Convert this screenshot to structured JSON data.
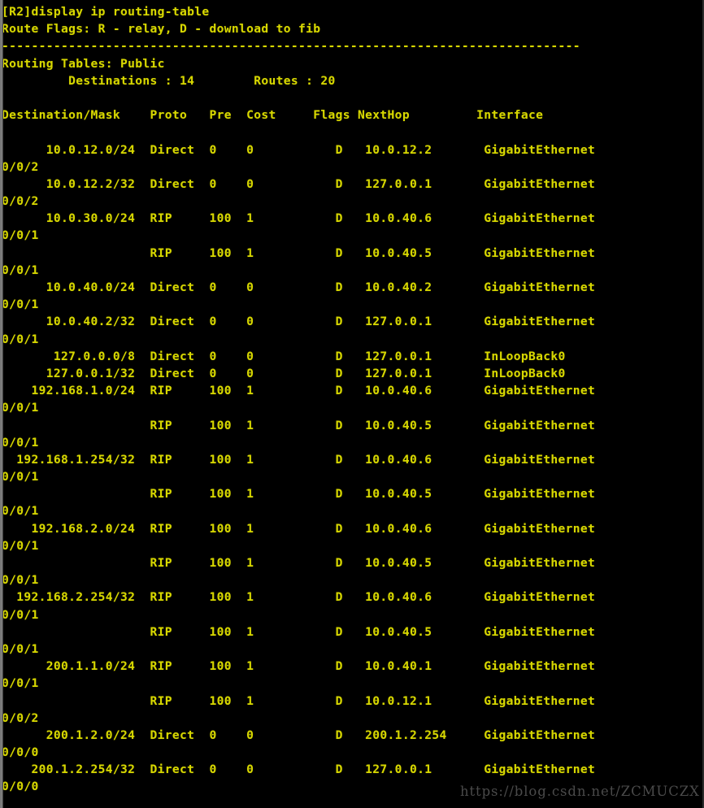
{
  "terminal": {
    "prompt_line": "[R2]display ip routing-table",
    "route_flags_line": "Route Flags: R - relay, D - download to fib",
    "separator": "------------------------------------------------------------------------------",
    "routing_tables_line": "Routing Tables: Public",
    "summary_line": "         Destinations : 14        Routes : 20",
    "blank": "",
    "header_line": "Destination/Mask    Proto   Pre  Cost     Flags NextHop         Interface",
    "columns": {
      "destination_mask": "Destination/Mask",
      "proto": "Proto",
      "pre": "Pre",
      "cost": "Cost",
      "flags": "Flags",
      "nexthop": "NextHop",
      "interface": "Interface"
    },
    "counts": {
      "destinations": "14",
      "routes": "20"
    },
    "watermark": "https://blog.csdn.net/ZCMUCZX",
    "colors": {
      "background": "#000000",
      "foreground": "#d7d700",
      "watermark": "#4a4a4a",
      "gutter": "#8a8a8a"
    },
    "routes": [
      {
        "destination_mask": "10.0.12.0/24",
        "proto": "Direct",
        "pre": "0",
        "cost": "0",
        "flags": "D",
        "nexthop": "10.0.12.2",
        "interface": "GigabitEthernet",
        "interface_cont": "0/0/2",
        "line": "      10.0.12.0/24  Direct  0    0           D   10.0.12.2       GigabitEthernet",
        "line_cont": "0/0/2"
      },
      {
        "destination_mask": "10.0.12.2/32",
        "proto": "Direct",
        "pre": "0",
        "cost": "0",
        "flags": "D",
        "nexthop": "127.0.0.1",
        "interface": "GigabitEthernet",
        "interface_cont": "0/0/2",
        "line": "      10.0.12.2/32  Direct  0    0           D   127.0.0.1       GigabitEthernet",
        "line_cont": "0/0/2"
      },
      {
        "destination_mask": "10.0.30.0/24",
        "proto": "RIP",
        "pre": "100",
        "cost": "1",
        "flags": "D",
        "nexthop": "10.0.40.6",
        "interface": "GigabitEthernet",
        "interface_cont": "0/0/1",
        "line": "      10.0.30.0/24  RIP     100  1           D   10.0.40.6       GigabitEthernet",
        "line_cont": "0/0/1"
      },
      {
        "destination_mask": "",
        "proto": "RIP",
        "pre": "100",
        "cost": "1",
        "flags": "D",
        "nexthop": "10.0.40.5",
        "interface": "GigabitEthernet",
        "interface_cont": "0/0/1",
        "line": "                    RIP     100  1           D   10.0.40.5       GigabitEthernet",
        "line_cont": "0/0/1"
      },
      {
        "destination_mask": "10.0.40.0/24",
        "proto": "Direct",
        "pre": "0",
        "cost": "0",
        "flags": "D",
        "nexthop": "10.0.40.2",
        "interface": "GigabitEthernet",
        "interface_cont": "0/0/1",
        "line": "      10.0.40.0/24  Direct  0    0           D   10.0.40.2       GigabitEthernet",
        "line_cont": "0/0/1"
      },
      {
        "destination_mask": "10.0.40.2/32",
        "proto": "Direct",
        "pre": "0",
        "cost": "0",
        "flags": "D",
        "nexthop": "127.0.0.1",
        "interface": "GigabitEthernet",
        "interface_cont": "0/0/1",
        "line": "      10.0.40.2/32  Direct  0    0           D   127.0.0.1       GigabitEthernet",
        "line_cont": "0/0/1"
      },
      {
        "destination_mask": "127.0.0.0/8",
        "proto": "Direct",
        "pre": "0",
        "cost": "0",
        "flags": "D",
        "nexthop": "127.0.0.1",
        "interface": "InLoopBack0",
        "interface_cont": "",
        "line": "       127.0.0.0/8  Direct  0    0           D   127.0.0.1       InLoopBack0",
        "line_cont": ""
      },
      {
        "destination_mask": "127.0.0.1/32",
        "proto": "Direct",
        "pre": "0",
        "cost": "0",
        "flags": "D",
        "nexthop": "127.0.0.1",
        "interface": "InLoopBack0",
        "interface_cont": "",
        "line": "      127.0.0.1/32  Direct  0    0           D   127.0.0.1       InLoopBack0",
        "line_cont": ""
      },
      {
        "destination_mask": "192.168.1.0/24",
        "proto": "RIP",
        "pre": "100",
        "cost": "1",
        "flags": "D",
        "nexthop": "10.0.40.6",
        "interface": "GigabitEthernet",
        "interface_cont": "0/0/1",
        "line": "    192.168.1.0/24  RIP     100  1           D   10.0.40.6       GigabitEthernet",
        "line_cont": "0/0/1"
      },
      {
        "destination_mask": "",
        "proto": "RIP",
        "pre": "100",
        "cost": "1",
        "flags": "D",
        "nexthop": "10.0.40.5",
        "interface": "GigabitEthernet",
        "interface_cont": "0/0/1",
        "line": "                    RIP     100  1           D   10.0.40.5       GigabitEthernet",
        "line_cont": "0/0/1"
      },
      {
        "destination_mask": "192.168.1.254/32",
        "proto": "RIP",
        "pre": "100",
        "cost": "1",
        "flags": "D",
        "nexthop": "10.0.40.6",
        "interface": "GigabitEthernet",
        "interface_cont": "0/0/1",
        "line": "  192.168.1.254/32  RIP     100  1           D   10.0.40.6       GigabitEthernet",
        "line_cont": "0/0/1"
      },
      {
        "destination_mask": "",
        "proto": "RIP",
        "pre": "100",
        "cost": "1",
        "flags": "D",
        "nexthop": "10.0.40.5",
        "interface": "GigabitEthernet",
        "interface_cont": "0/0/1",
        "line": "                    RIP     100  1           D   10.0.40.5       GigabitEthernet",
        "line_cont": "0/0/1"
      },
      {
        "destination_mask": "192.168.2.0/24",
        "proto": "RIP",
        "pre": "100",
        "cost": "1",
        "flags": "D",
        "nexthop": "10.0.40.6",
        "interface": "GigabitEthernet",
        "interface_cont": "0/0/1",
        "line": "    192.168.2.0/24  RIP     100  1           D   10.0.40.6       GigabitEthernet",
        "line_cont": "0/0/1"
      },
      {
        "destination_mask": "",
        "proto": "RIP",
        "pre": "100",
        "cost": "1",
        "flags": "D",
        "nexthop": "10.0.40.5",
        "interface": "GigabitEthernet",
        "interface_cont": "0/0/1",
        "line": "                    RIP     100  1           D   10.0.40.5       GigabitEthernet",
        "line_cont": "0/0/1"
      },
      {
        "destination_mask": "192.168.2.254/32",
        "proto": "RIP",
        "pre": "100",
        "cost": "1",
        "flags": "D",
        "nexthop": "10.0.40.6",
        "interface": "GigabitEthernet",
        "interface_cont": "0/0/1",
        "line": "  192.168.2.254/32  RIP     100  1           D   10.0.40.6       GigabitEthernet",
        "line_cont": "0/0/1"
      },
      {
        "destination_mask": "",
        "proto": "RIP",
        "pre": "100",
        "cost": "1",
        "flags": "D",
        "nexthop": "10.0.40.5",
        "interface": "GigabitEthernet",
        "interface_cont": "0/0/1",
        "line": "                    RIP     100  1           D   10.0.40.5       GigabitEthernet",
        "line_cont": "0/0/1"
      },
      {
        "destination_mask": "200.1.1.0/24",
        "proto": "RIP",
        "pre": "100",
        "cost": "1",
        "flags": "D",
        "nexthop": "10.0.40.1",
        "interface": "GigabitEthernet",
        "interface_cont": "0/0/1",
        "line": "      200.1.1.0/24  RIP     100  1           D   10.0.40.1       GigabitEthernet",
        "line_cont": "0/0/1"
      },
      {
        "destination_mask": "",
        "proto": "RIP",
        "pre": "100",
        "cost": "1",
        "flags": "D",
        "nexthop": "10.0.12.1",
        "interface": "GigabitEthernet",
        "interface_cont": "0/0/2",
        "line": "                    RIP     100  1           D   10.0.12.1       GigabitEthernet",
        "line_cont": "0/0/2"
      },
      {
        "destination_mask": "200.1.2.0/24",
        "proto": "Direct",
        "pre": "0",
        "cost": "0",
        "flags": "D",
        "nexthop": "200.1.2.254",
        "interface": "GigabitEthernet",
        "interface_cont": "0/0/0",
        "line": "      200.1.2.0/24  Direct  0    0           D   200.1.2.254     GigabitEthernet",
        "line_cont": "0/0/0"
      },
      {
        "destination_mask": "200.1.2.254/32",
        "proto": "Direct",
        "pre": "0",
        "cost": "0",
        "flags": "D",
        "nexthop": "127.0.0.1",
        "interface": "GigabitEthernet",
        "interface_cont": "0/0/0",
        "line": "    200.1.2.254/32  Direct  0    0           D   127.0.0.1       GigabitEthernet",
        "line_cont": "0/0/0"
      }
    ]
  }
}
